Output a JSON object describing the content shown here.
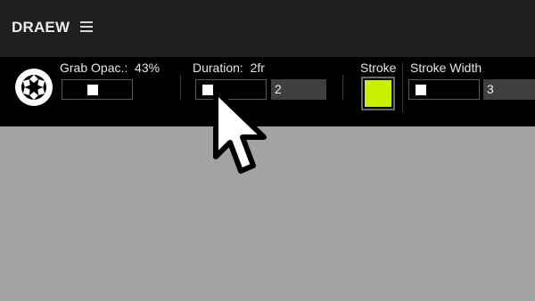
{
  "app": {
    "title": "DRAEW"
  },
  "toolbar": {
    "grab_opacity": {
      "label": "Grab Opac.:",
      "value": "43%",
      "fraction": 0.43
    },
    "duration": {
      "label": "Duration:",
      "value": "2fr",
      "number": "2"
    },
    "stroke": {
      "label": "Stroke",
      "color": "#c8f000"
    },
    "stroke_width": {
      "label": "Stroke Width",
      "number": "3"
    }
  },
  "icons": {
    "menu": "hamburger-menu-icon",
    "camera": "camera-aperture-icon",
    "cursor": "mouse-pointer-icon"
  }
}
